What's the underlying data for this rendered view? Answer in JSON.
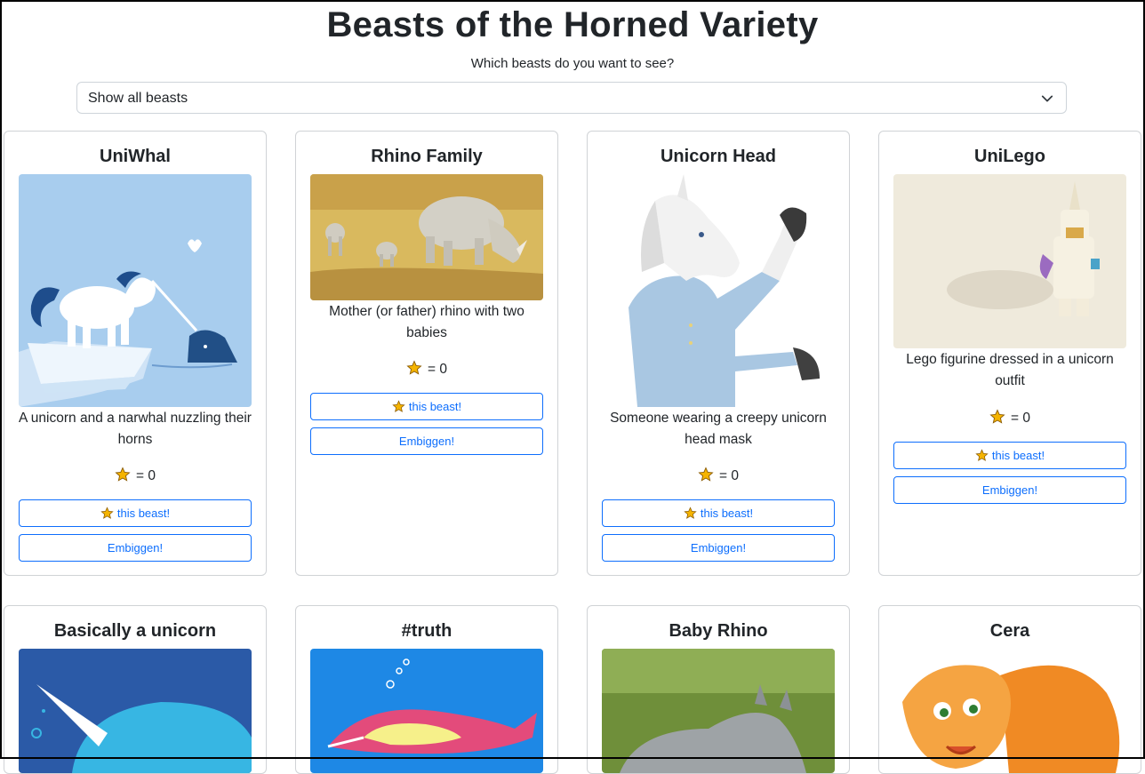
{
  "page": {
    "title": "Beasts of the Horned Variety",
    "subtitle": "Which beasts do you want to see?"
  },
  "filter": {
    "selected": "Show all beasts"
  },
  "beasts": [
    {
      "title": "UniWhal",
      "description": "A unicorn and a narwhal nuzzling their horns",
      "votes_text": "= 0",
      "vote_label": "this beast!",
      "enlarge_label": "Embiggen!"
    },
    {
      "title": "Rhino Family",
      "description": "Mother (or father) rhino with two babies",
      "votes_text": "= 0",
      "vote_label": "this beast!",
      "enlarge_label": "Embiggen!"
    },
    {
      "title": "Unicorn Head",
      "description": "Someone wearing a creepy unicorn head mask",
      "votes_text": "= 0",
      "vote_label": "this beast!",
      "enlarge_label": "Embiggen!"
    },
    {
      "title": "UniLego",
      "description": "Lego figurine dressed in a unicorn outfit",
      "votes_text": "= 0",
      "vote_label": "this beast!",
      "enlarge_label": "Embiggen!"
    },
    {
      "title": "Basically a unicorn"
    },
    {
      "title": "#truth"
    },
    {
      "title": "Baby Rhino"
    },
    {
      "title": "Cera"
    }
  ],
  "colors": {
    "primary": "#0d6efd",
    "star": "#f5b400"
  },
  "icons": {
    "dropdown": "chevron-down-icon",
    "vote": "star-icon"
  }
}
